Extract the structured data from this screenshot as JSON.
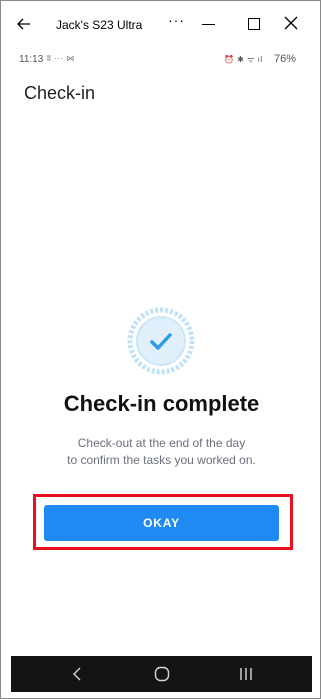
{
  "window": {
    "title": "Jack's S23 Ultra",
    "more_label": "···"
  },
  "status_bar": {
    "time": "11:13",
    "left_icons": "ʬ ··· ⋈",
    "right_icons": "⏰ ✱ ᯤ ıl",
    "battery": "76%"
  },
  "app": {
    "title": "Check-in"
  },
  "content": {
    "headline": "Check-in complete",
    "subtext_line1": "Check-out at the end of the day",
    "subtext_line2": "to confirm the tasks you worked on.",
    "okay_label": "OKAY"
  },
  "colors": {
    "accent_blue": "#1f8bf2",
    "highlight_red": "#e8101e",
    "check_circle": "#bfe2f7",
    "check_inner": "#dff0fb",
    "check_mark": "#2e9be6"
  },
  "icons": {
    "back": "arrow-left-icon",
    "minimize": "minimize-icon",
    "maximize": "maximize-icon",
    "close": "close-icon",
    "check": "check-circle-icon",
    "nav_back": "chevron-left-icon",
    "nav_home": "home-circle-icon",
    "nav_recents": "recents-icon"
  }
}
